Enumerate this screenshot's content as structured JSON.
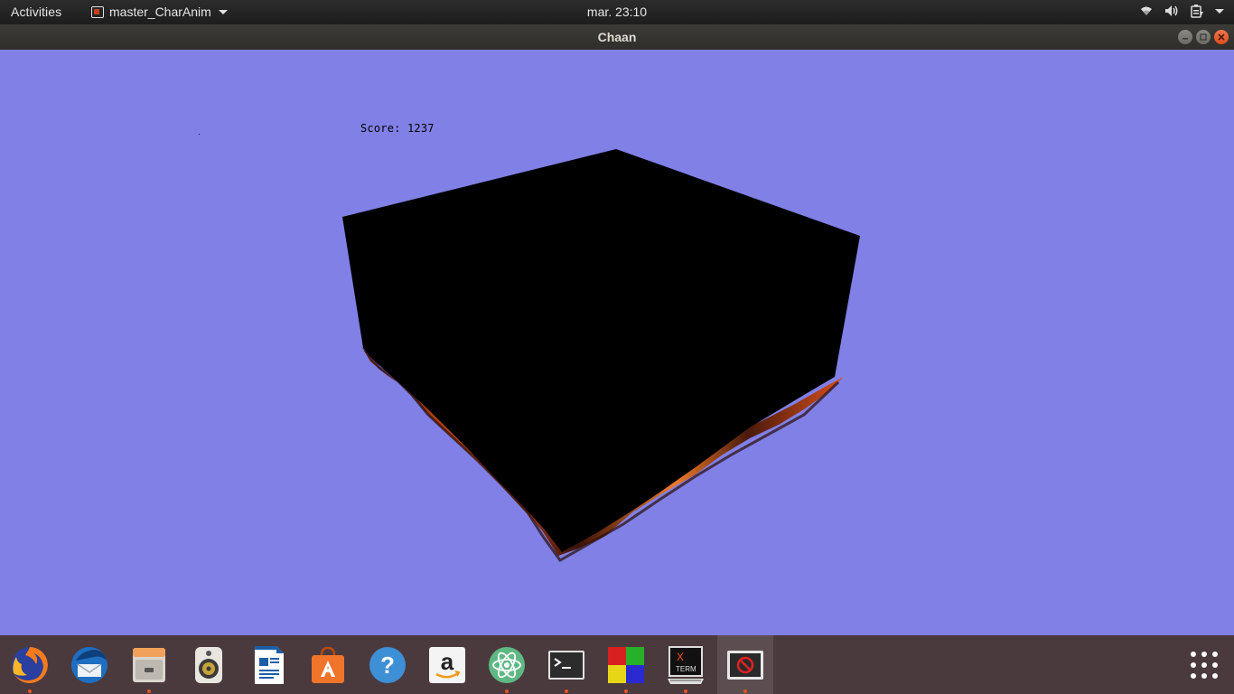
{
  "top_panel": {
    "activities_label": "Activities",
    "app_menu_label": "master_CharAnim",
    "clock": "mar. 23:10"
  },
  "window": {
    "title": "Chaan"
  },
  "game": {
    "score_text": "Score: 1237",
    "sky_color": "#8080e6",
    "cube_color": "#000000",
    "lava_color": "#e2561c"
  },
  "dock": {
    "items": [
      {
        "name": "firefox",
        "running": true
      },
      {
        "name": "thunderbird",
        "running": false
      },
      {
        "name": "files",
        "running": true
      },
      {
        "name": "rhythmbox",
        "running": false
      },
      {
        "name": "libreoffice-writer",
        "running": false
      },
      {
        "name": "ubuntu-software",
        "running": false
      },
      {
        "name": "help",
        "running": false
      },
      {
        "name": "amazon",
        "running": false
      },
      {
        "name": "atom",
        "running": true
      },
      {
        "name": "terminal",
        "running": true
      },
      {
        "name": "tetris-game",
        "running": true
      },
      {
        "name": "xterm",
        "running": true
      },
      {
        "name": "chaan-game",
        "running": true,
        "active": true
      }
    ],
    "xterm_label_x": "X",
    "xterm_label_term": "TERM"
  },
  "colors": {
    "accent": "#e95420",
    "panel": "#1d1d1d",
    "dock": "#4a3a3d"
  }
}
